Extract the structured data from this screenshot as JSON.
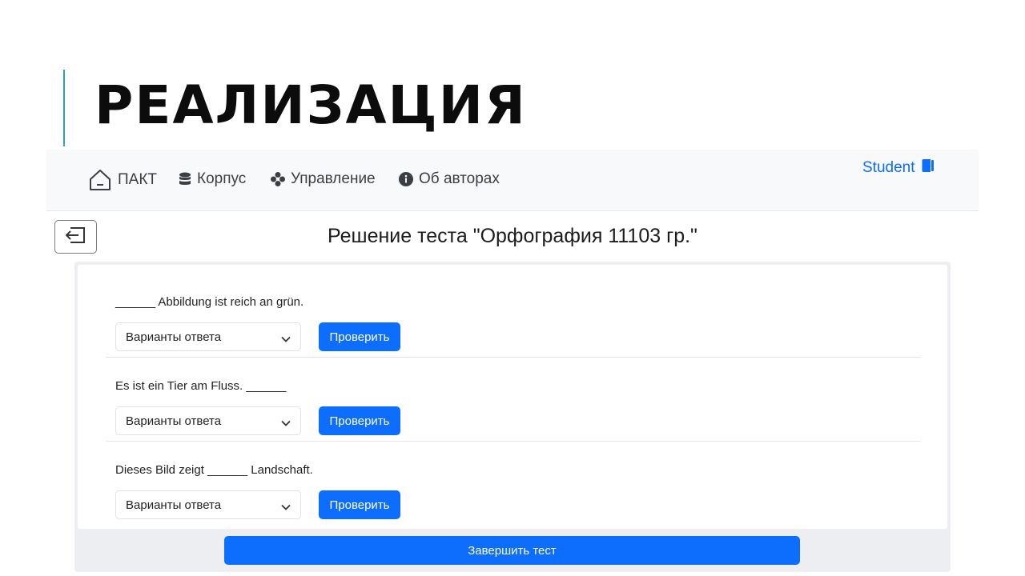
{
  "slide": {
    "title": "РЕАЛИЗАЦИЯ",
    "accent_color": "#2e9fc7"
  },
  "navbar": {
    "brand": {
      "label": "ПАКТ",
      "icon": "home-icon"
    },
    "items": [
      {
        "label": "Корпус",
        "icon": "database-icon"
      },
      {
        "label": "Управление",
        "icon": "gear-icon"
      },
      {
        "label": "Об авторах",
        "icon": "info-icon"
      }
    ],
    "user": {
      "label": "Student",
      "icon": "user-book-icon"
    }
  },
  "page": {
    "back_icon": "exit-icon",
    "heading": "Решение теста \"Орфография 11103 гр.\""
  },
  "questions": [
    {
      "text": "______ Abbildung ist reich an grün.",
      "select_value": "Варианты ответа",
      "check_label": "Проверить"
    },
    {
      "text": "Es ist ein Tier am Fluss. ______",
      "select_value": "Варианты ответа",
      "check_label": "Проверить"
    },
    {
      "text": "Dieses Bild zeigt ______ Landschaft.",
      "select_value": "Варианты ответа",
      "check_label": "Проверить"
    }
  ],
  "finish_label": "Завершить тест",
  "colors": {
    "primary": "#0d6efd",
    "navbar_bg": "#f8f9fa",
    "panel_bg": "#eceef1"
  }
}
